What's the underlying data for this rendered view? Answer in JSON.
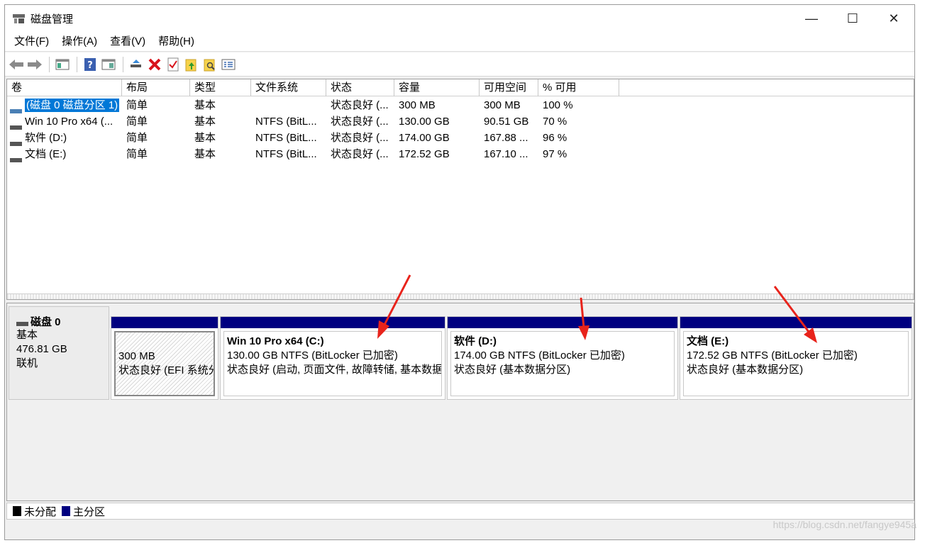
{
  "window": {
    "title": "磁盘管理",
    "controls": {
      "minimize": "—",
      "maximize": "☐",
      "close": "✕"
    }
  },
  "menu": [
    "文件(F)",
    "操作(A)",
    "查看(V)",
    "帮助(H)"
  ],
  "toolbar": {
    "icons": [
      "back-arrow-icon",
      "forward-arrow-icon",
      "console-tree-icon",
      "help-icon",
      "properties-icon",
      "connect-drive-icon",
      "delete-icon",
      "check-icon",
      "folder-up-icon",
      "folder-search-icon",
      "list-view-icon"
    ]
  },
  "volume_table": {
    "headers": [
      "卷",
      "布局",
      "类型",
      "文件系统",
      "状态",
      "容量",
      "可用空间",
      "% 可用"
    ],
    "rows": [
      [
        "(磁盘 0 磁盘分区 1)",
        "简单",
        "基本",
        "",
        "状态良好 (...",
        "300 MB",
        "300 MB",
        "100 %"
      ],
      [
        "Win 10 Pro x64 (...",
        "简单",
        "基本",
        "NTFS (BitL...",
        "状态良好 (...",
        "130.00 GB",
        "90.51 GB",
        "70 %"
      ],
      [
        "软件 (D:)",
        "简单",
        "基本",
        "NTFS (BitL...",
        "状态良好 (...",
        "174.00 GB",
        "167.88 ...",
        "96 %"
      ],
      [
        "文档 (E:)",
        "简单",
        "基本",
        "NTFS (BitL...",
        "状态良好 (...",
        "172.52 GB",
        "167.10 ...",
        "97 %"
      ]
    ]
  },
  "disk": {
    "name": "磁盘 0",
    "type": "基本",
    "size": "476.81 GB",
    "status": "联机",
    "partitions": [
      {
        "name": "",
        "line1": "300 MB",
        "line2": "状态良好 (EFI 系统分"
      },
      {
        "name": "Win 10 Pro x64  (C:)",
        "line1": "130.00 GB NTFS (BitLocker 已加密)",
        "line2": "状态良好 (启动, 页面文件, 故障转储, 基本数据"
      },
      {
        "name": "软件  (D:)",
        "line1": "174.00 GB NTFS (BitLocker 已加密)",
        "line2": "状态良好 (基本数据分区)"
      },
      {
        "name": "文档  (E:)",
        "line1": "172.52 GB NTFS (BitLocker 已加密)",
        "line2": "状态良好 (基本数据分区)"
      }
    ]
  },
  "legend": {
    "unallocated": "未分配",
    "primary": "主分区",
    "colors": {
      "unallocated": "#000000",
      "primary": "#000080"
    }
  },
  "watermark": "https://blog.csdn.net/fangye945a",
  "colors": {
    "selection": "#0078d7",
    "partition_bar": "#000080",
    "annotation_arrow": "#e8231b"
  }
}
